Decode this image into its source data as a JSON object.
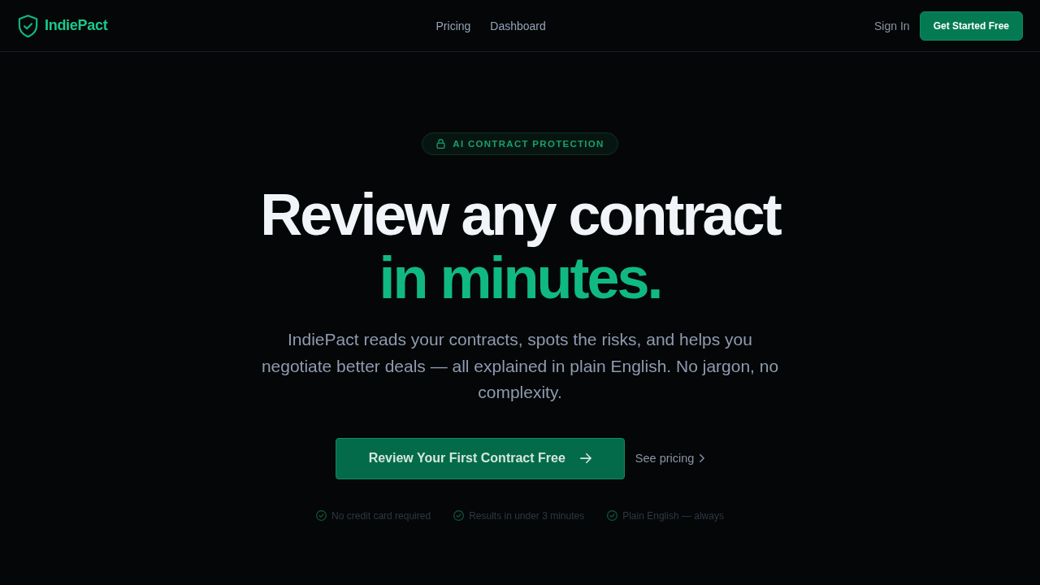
{
  "nav": {
    "logo": "IndiePact",
    "links": [
      {
        "label": "Pricing"
      },
      {
        "label": "Dashboard"
      }
    ],
    "sign_in": "Sign In",
    "cta": "Get Started Free"
  },
  "hero": {
    "badge": "AI CONTRACT PROTECTION",
    "headline": [
      {
        "text": "Review any contract",
        "highlight": false
      },
      {
        "text": "in minutes.",
        "highlight": true
      }
    ],
    "description": "IndiePact reads your contracts, spots the risks, and helps you negotiate better deals — all explained in plain English. No jargon, no complexity.",
    "primary_button": "Review Your First Contract Free",
    "secondary_link": "See pricing",
    "assurances": [
      "No credit card required",
      "Results in under 3 minutes",
      "Plain English — always"
    ]
  }
}
